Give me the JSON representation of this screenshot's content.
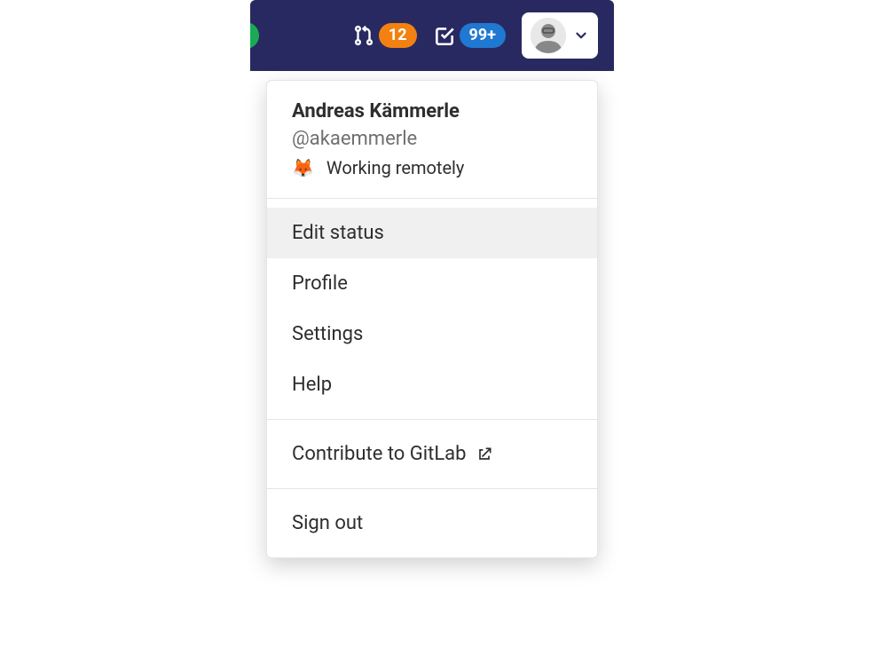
{
  "navbar": {
    "merge_requests": {
      "count": "12"
    },
    "todos": {
      "count": "99+"
    }
  },
  "user": {
    "name": "Andreas Kämmerle",
    "handle": "@akaemmerle",
    "status_emoji": "🦊",
    "status_text": "Working remotely"
  },
  "menu": {
    "edit_status": "Edit status",
    "profile": "Profile",
    "settings": "Settings",
    "help": "Help",
    "contribute": "Contribute to GitLab",
    "sign_out": "Sign out"
  }
}
